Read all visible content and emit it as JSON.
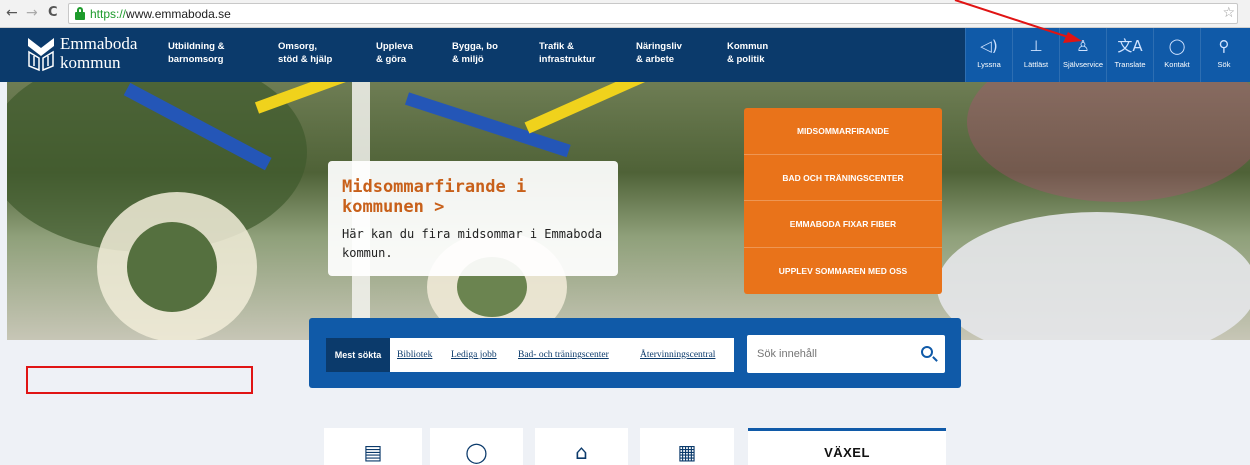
{
  "browser": {
    "back": "←",
    "forward": "→",
    "reload": "C",
    "url_scheme": "https://",
    "url_host": "www.emmaboda.se"
  },
  "logo": {
    "line1": "Emmaboda",
    "line2": "kommun"
  },
  "nav": [
    {
      "l1": "Utbildning &",
      "l2": "barnomsorg"
    },
    {
      "l1": "Omsorg,",
      "l2": "stöd & hjälp"
    },
    {
      "l1": "Uppleva",
      "l2": "& göra"
    },
    {
      "l1": "Bygga, bo",
      "l2": "& miljö"
    },
    {
      "l1": "Trafik &",
      "l2": "infrastruktur"
    },
    {
      "l1": "Näringsliv",
      "l2": "& arbete"
    },
    {
      "l1": "Kommun",
      "l2": "& politik"
    }
  ],
  "utils": [
    {
      "icon": "speaker-icon",
      "label": "Lyssna"
    },
    {
      "icon": "easy-read-icon",
      "label": "Lättläst"
    },
    {
      "icon": "user-icon",
      "label": "Självservice"
    },
    {
      "icon": "translate-icon",
      "label": "Translate"
    },
    {
      "icon": "chat-icon",
      "label": "Kontakt"
    },
    {
      "icon": "search-icon",
      "label": "Sök"
    }
  ],
  "hero": {
    "title": "Midsommarfirande i kommunen >",
    "text": "Här kan du fira midsommar i Emmaboda kommun."
  },
  "promo": [
    "MIDSOMMARFIRANDE",
    "BAD OCH TRÄNINGSCENTER",
    "EMMABODA FIXAR FIBER",
    "UPPLEV SOMMAREN MED OSS"
  ],
  "quick": {
    "label": "Mest sökta",
    "links": [
      "Bibliotek",
      "Lediga jobb",
      "Bad- och träningscenter",
      "Återvinningscentral"
    ]
  },
  "search": {
    "placeholder": "Sök innehåll"
  },
  "tiles": {
    "vaxel": "VÄXEL"
  },
  "colors": {
    "navy": "#0b3a6b",
    "blue": "#105aa8",
    "orange": "#e9731a",
    "annotation": "#e01414"
  }
}
